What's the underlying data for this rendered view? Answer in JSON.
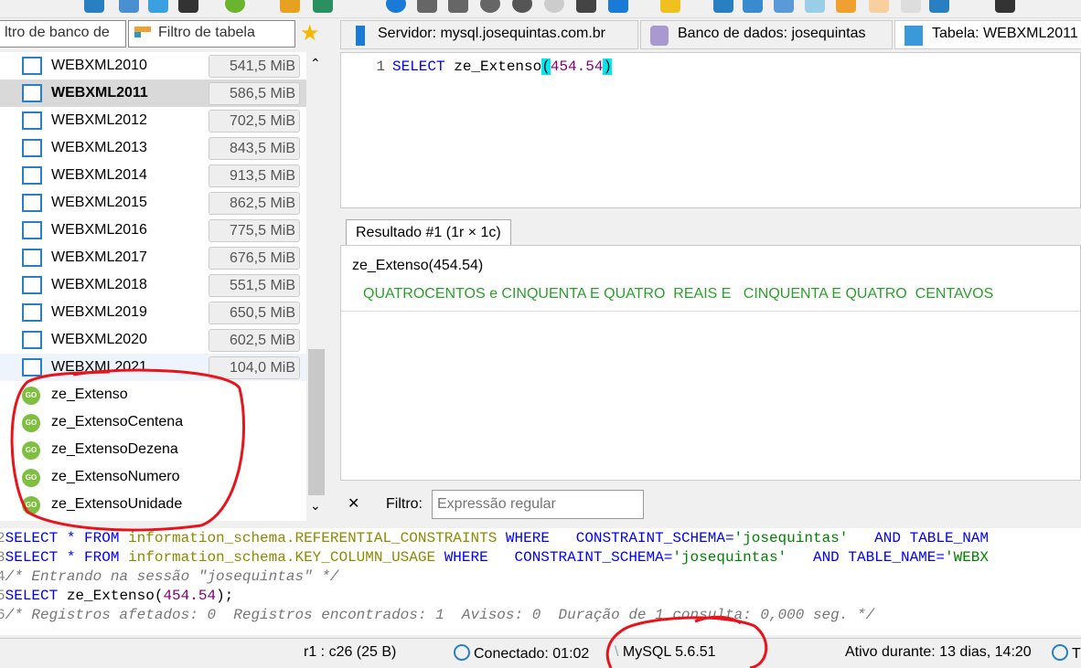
{
  "filters": {
    "db_filter": "ltro de banco de",
    "table_filter": "Filtro de tabela"
  },
  "tabs": [
    {
      "label": "Servidor: mysql.josequintas.com.br"
    },
    {
      "label": "Banco de dados: josequintas"
    },
    {
      "label": "Tabela: WEBXML2011"
    }
  ],
  "tree": {
    "tables": [
      {
        "name": "WEBXML2010",
        "size": "541,5 MiB",
        "fill": 0.59
      },
      {
        "name": "WEBXML2011",
        "size": "586,5 MiB",
        "fill": 0.64,
        "selected": true
      },
      {
        "name": "WEBXML2012",
        "size": "702,5 MiB",
        "fill": 0.77
      },
      {
        "name": "WEBXML2013",
        "size": "843,5 MiB",
        "fill": 0.92
      },
      {
        "name": "WEBXML2014",
        "size": "913,5 MiB",
        "fill": 1.0
      },
      {
        "name": "WEBXML2015",
        "size": "862,5 MiB",
        "fill": 0.94
      },
      {
        "name": "WEBXML2016",
        "size": "775,5 MiB",
        "fill": 0.85
      },
      {
        "name": "WEBXML2017",
        "size": "676,5 MiB",
        "fill": 0.74
      },
      {
        "name": "WEBXML2018",
        "size": "551,5 MiB",
        "fill": 0.6
      },
      {
        "name": "WEBXML2019",
        "size": "650,5 MiB",
        "fill": 0.71
      },
      {
        "name": "WEBXML2020",
        "size": "602,5 MiB",
        "fill": 0.66
      },
      {
        "name": "WEBXML2021",
        "size": "104,0 MiB",
        "fill": 0.11
      }
    ],
    "functions": [
      "ze_Extenso",
      "ze_ExtensoCentena",
      "ze_ExtensoDezena",
      "ze_ExtensoNumero",
      "ze_ExtensoUnidade"
    ],
    "function_badge": "GO"
  },
  "editor": {
    "line": "1",
    "kw": "SELECT",
    "fn": "ze_Extenso",
    "open": "(",
    "arg": "454.54",
    "close": ")"
  },
  "results": {
    "tab": "Resultado #1 (1r × 1c)",
    "column": "ze_Extenso(454.54)",
    "value": "QUATROCENTOS e CINQUENTA E QUATRO  REAIS E   CINQUENTA E QUATRO  CENTAVOS"
  },
  "filter_bar": {
    "close": "✕",
    "label": "Filtro:",
    "placeholder": "Expressão regular"
  },
  "log": [
    [
      [
        "kw",
        "SELECT * FROM "
      ],
      [
        "ob",
        "information_schema.REFERENTIAL_CONSTRAINTS "
      ],
      [
        "kw",
        "WHERE   CONSTRAINT_SCHEMA="
      ],
      [
        "str",
        "'josequintas'"
      ],
      [
        "kw",
        "   AND TABLE_NAM"
      ]
    ],
    [
      [
        "kw",
        "SELECT * FROM "
      ],
      [
        "ob",
        "information_schema.KEY_COLUMN_USAGE "
      ],
      [
        "kw",
        "WHERE   CONSTRAINT_SCHEMA="
      ],
      [
        "str",
        "'josequintas'"
      ],
      [
        "kw",
        "   AND TABLE_NAME="
      ],
      [
        "str",
        "'WEBX"
      ]
    ],
    [
      [
        "cm",
        "/* Entrando na sessão \"josequintas\" */"
      ]
    ],
    [
      [
        "kw",
        "SELECT "
      ],
      [
        "",
        "ze_Extenso("
      ],
      [
        "num",
        "454.54"
      ],
      [
        "",
        "); "
      ]
    ],
    [
      [
        "cm",
        "/* Registros afetados: 0  Registros encontrados: 1  Avisos: 0  Duração de 1 consulta: 0,000 seg. */"
      ]
    ]
  ],
  "log_gutter": [
    "2",
    "3",
    "4",
    "5",
    "6"
  ],
  "status": {
    "pos": "r1 : c26 (25 B)",
    "connected": "Conectado: 01:02",
    "server": "MySQL 5.6.51",
    "uptime": "Ativo durante: 13 dias, 14:20",
    "extra": "T"
  }
}
